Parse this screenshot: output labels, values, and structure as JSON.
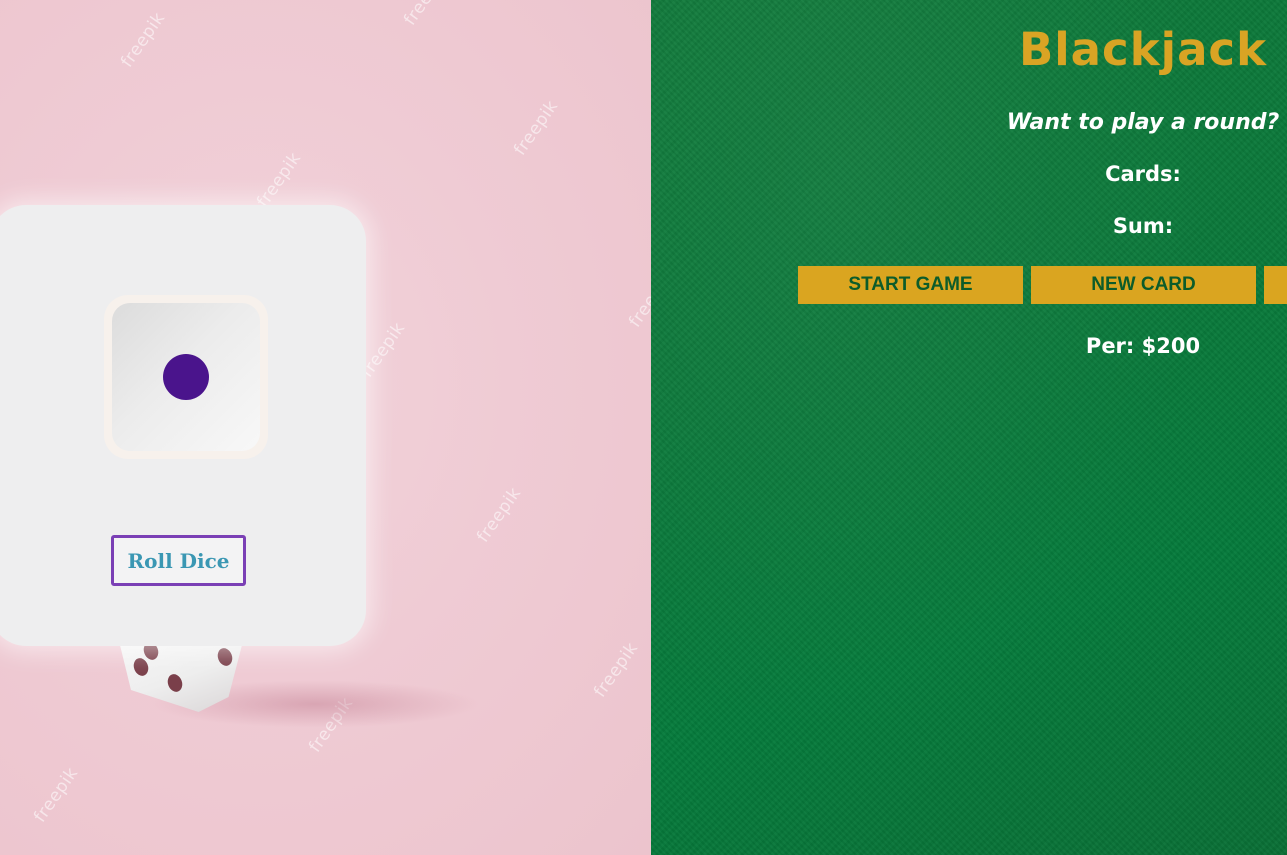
{
  "dice_panel": {
    "watermark_text": "freepik",
    "die_value": 1,
    "roll_button_label": "Roll Dice",
    "pip_color": "#4a148c",
    "button_border_color": "#7a3fb5",
    "button_text_color": "#3a97b3"
  },
  "blackjack": {
    "title": "Blackjack",
    "message": "Want to play a round?",
    "cards_label": "Cards:",
    "sum_label": "Sum:",
    "buttons": {
      "start_game": "START GAME",
      "new_card": "NEW CARD"
    },
    "player_info": "Per: $200",
    "title_color": "#d9a424",
    "button_color": "#daa520",
    "table_color": "#0b7a3b"
  }
}
